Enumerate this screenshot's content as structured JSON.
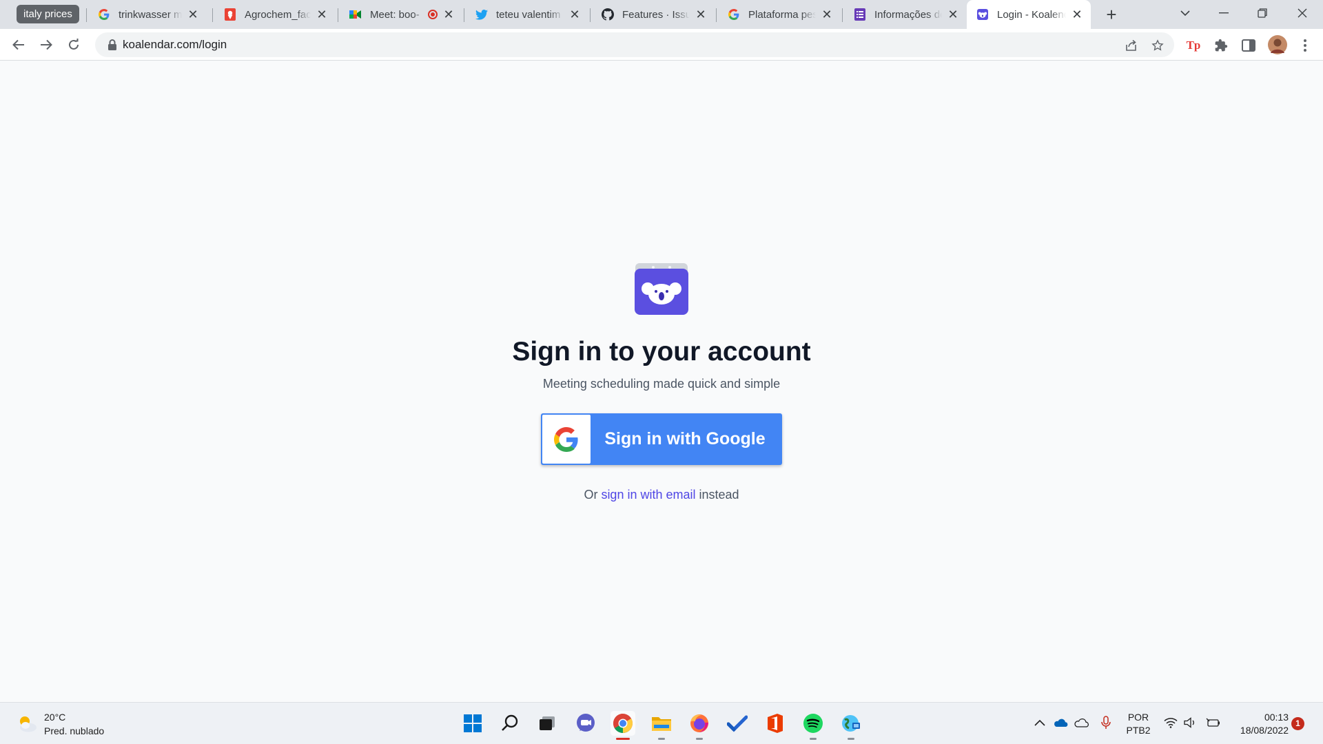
{
  "browser": {
    "tab_group_label": "italy prices",
    "tabs": [
      {
        "title": "trinkwasser messen",
        "favicon": "google-icon"
      },
      {
        "title": "Agrochem_facility",
        "favicon": "maps-pin-icon"
      },
      {
        "title": "Meet: boo-",
        "favicon": "meet-icon"
      },
      {
        "title": "teteu valentim",
        "favicon": "twitter-icon"
      },
      {
        "title": "Features · Issues",
        "favicon": "github-icon"
      },
      {
        "title": "Plataforma pesquisa",
        "favicon": "google-icon"
      },
      {
        "title": "Informações de",
        "favicon": "forms-icon"
      },
      {
        "title": "Login - Koalendar",
        "favicon": "koalendar-icon"
      }
    ],
    "address": "koalendar.com/login",
    "accent": "#4285f4"
  },
  "page": {
    "heading": "Sign in to your account",
    "subheading": "Meeting scheduling made quick and simple",
    "google_button_label": "Sign in with Google",
    "alt_prefix": "Or ",
    "alt_link": "sign in with email",
    "alt_suffix": " instead",
    "brand_color": "#5b4fe0"
  },
  "taskbar": {
    "weather_temp": "20°C",
    "weather_desc": "Pred. nublado",
    "language_line1": "POR",
    "language_line2": "PTB2",
    "time": "00:13",
    "date": "18/08/2022",
    "notification_count": "1",
    "apps": [
      "windows-start-icon",
      "search-icon",
      "task-view-icon",
      "teams-chat-icon",
      "chrome-icon",
      "file-explorer-icon",
      "firefox-icon",
      "todo-icon",
      "office-icon",
      "spotify-icon",
      "remote-desktop-icon"
    ]
  }
}
